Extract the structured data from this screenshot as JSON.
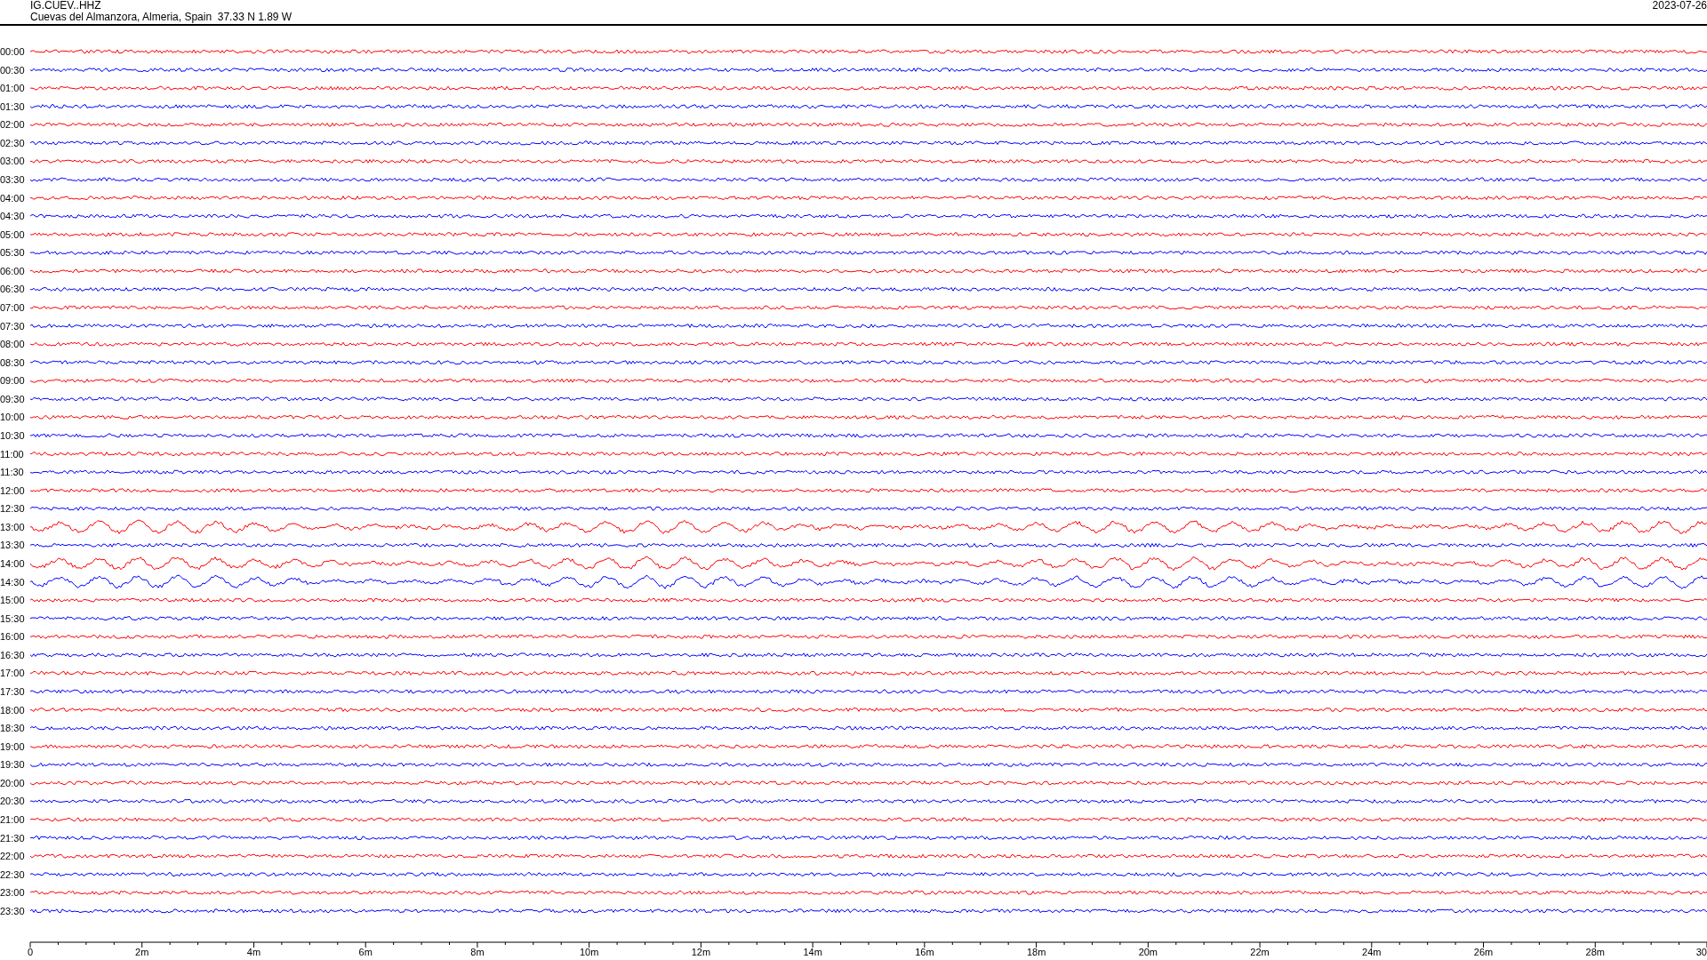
{
  "header": {
    "station": "IG.CUEV..HHZ",
    "location": "Cuevas del Almanzora, Almeria, Spain  37.33 N 1.89 W",
    "date": "2023-07-26"
  },
  "rows": [
    {
      "time": "00:00",
      "color": "#ff0000",
      "kind": "quiet"
    },
    {
      "time": "00:30",
      "color": "#0000ff",
      "kind": "quiet"
    },
    {
      "time": "01:00",
      "color": "#ff0000",
      "kind": "quiet"
    },
    {
      "time": "01:30",
      "color": "#0000ff",
      "kind": "quiet"
    },
    {
      "time": "02:00",
      "color": "#ff0000",
      "kind": "quiet"
    },
    {
      "time": "02:30",
      "color": "#0000ff",
      "kind": "quiet"
    },
    {
      "time": "03:00",
      "color": "#ff0000",
      "kind": "quiet"
    },
    {
      "time": "03:30",
      "color": "#0000ff",
      "kind": "quiet"
    },
    {
      "time": "04:00",
      "color": "#ff0000",
      "kind": "quiet"
    },
    {
      "time": "04:30",
      "color": "#0000ff",
      "kind": "quiet"
    },
    {
      "time": "05:00",
      "color": "#ff0000",
      "kind": "quiet"
    },
    {
      "time": "05:30",
      "color": "#0000ff",
      "kind": "quiet"
    },
    {
      "time": "06:00",
      "color": "#ff0000",
      "kind": "quiet"
    },
    {
      "time": "06:30",
      "color": "#0000ff",
      "kind": "quiet"
    },
    {
      "time": "07:00",
      "color": "#ff0000",
      "kind": "quiet"
    },
    {
      "time": "07:30",
      "color": "#0000ff",
      "kind": "quiet"
    },
    {
      "time": "08:00",
      "color": "#ff0000",
      "kind": "quiet"
    },
    {
      "time": "08:30",
      "color": "#0000ff",
      "kind": "quiet"
    },
    {
      "time": "09:00",
      "color": "#ff0000",
      "kind": "quiet"
    },
    {
      "time": "09:30",
      "color": "#0000ff",
      "kind": "quiet"
    },
    {
      "time": "10:00",
      "color": "#ff0000",
      "kind": "quiet"
    },
    {
      "time": "10:30",
      "color": "#0000ff",
      "kind": "quiet"
    },
    {
      "time": "11:00",
      "color": "#ff0000",
      "kind": "quiet"
    },
    {
      "time": "11:30",
      "color": "#0000ff",
      "kind": "quiet"
    },
    {
      "time": "12:00",
      "color": "#ff0000",
      "kind": "quiet"
    },
    {
      "time": "12:30",
      "color": "#0000ff",
      "kind": "quiet"
    },
    {
      "time": "13:00",
      "color": "#ff0000",
      "kind": "waves"
    },
    {
      "time": "13:30",
      "color": "#0000ff",
      "kind": "quiet"
    },
    {
      "time": "14:00",
      "color": "#ff0000",
      "kind": "waves"
    },
    {
      "time": "14:30",
      "color": "#0000ff",
      "kind": "waves"
    },
    {
      "time": "15:00",
      "color": "#ff0000",
      "kind": "quiet"
    },
    {
      "time": "15:30",
      "color": "#0000ff",
      "kind": "quiet"
    },
    {
      "time": "16:00",
      "color": "#ff0000",
      "kind": "quiet"
    },
    {
      "time": "16:30",
      "color": "#0000ff",
      "kind": "quiet"
    },
    {
      "time": "17:00",
      "color": "#ff0000",
      "kind": "quiet"
    },
    {
      "time": "17:30",
      "color": "#0000ff",
      "kind": "quiet"
    },
    {
      "time": "18:00",
      "color": "#ff0000",
      "kind": "quiet"
    },
    {
      "time": "18:30",
      "color": "#0000ff",
      "kind": "quiet"
    },
    {
      "time": "19:00",
      "color": "#ff0000",
      "kind": "quiet"
    },
    {
      "time": "19:30",
      "color": "#0000ff",
      "kind": "quiet"
    },
    {
      "time": "20:00",
      "color": "#ff0000",
      "kind": "quiet"
    },
    {
      "time": "20:30",
      "color": "#0000ff",
      "kind": "quiet"
    },
    {
      "time": "21:00",
      "color": "#ff0000",
      "kind": "quiet"
    },
    {
      "time": "21:30",
      "color": "#0000ff",
      "kind": "quiet"
    },
    {
      "time": "22:00",
      "color": "#ff0000",
      "kind": "quiet"
    },
    {
      "time": "22:30",
      "color": "#0000ff",
      "kind": "quiet"
    },
    {
      "time": "23:00",
      "color": "#ff0000",
      "kind": "quiet"
    },
    {
      "time": "23:30",
      "color": "#0000ff",
      "kind": "quiet"
    }
  ],
  "x_axis": {
    "labels": [
      "0",
      "2m",
      "4m",
      "6m",
      "8m",
      "10m",
      "12m",
      "14m",
      "16m",
      "18m",
      "20m",
      "22m",
      "24m",
      "26m",
      "28m",
      "30"
    ]
  }
}
